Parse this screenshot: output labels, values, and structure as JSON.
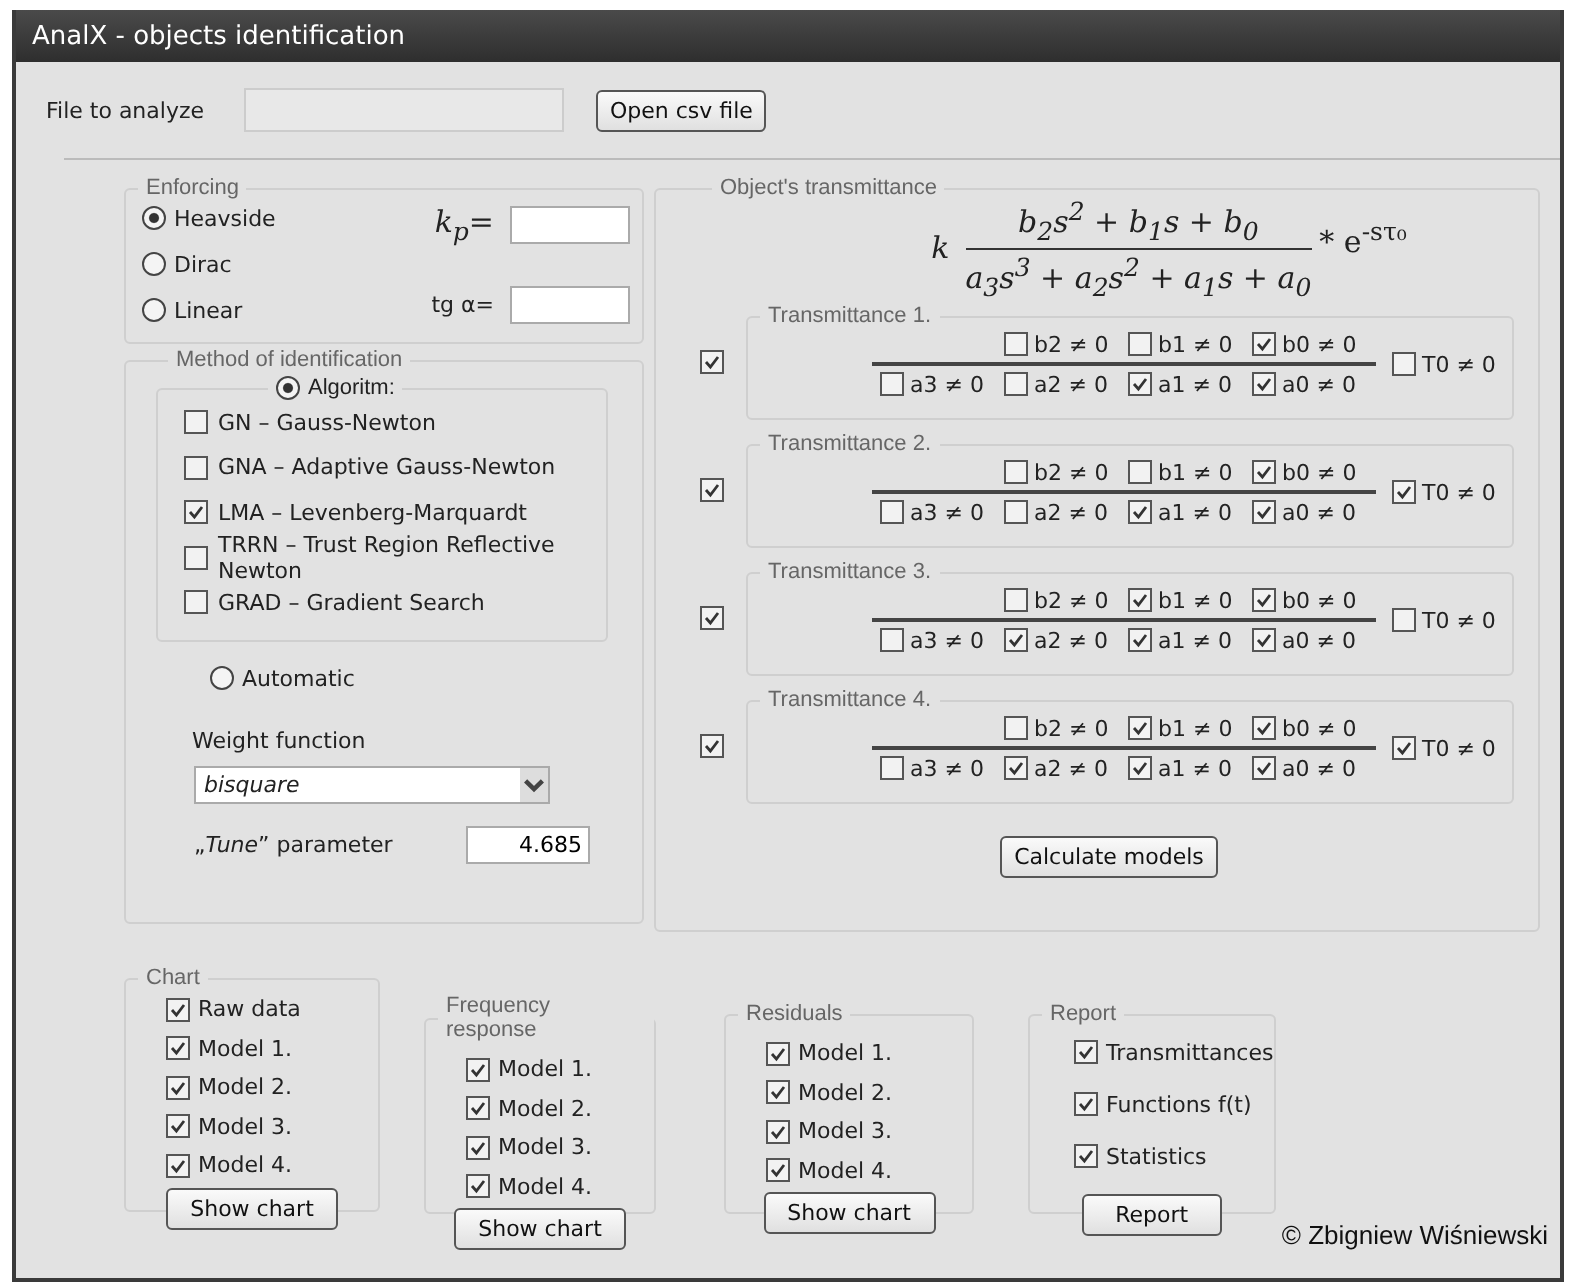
{
  "window": {
    "title": "AnalX - objects identification"
  },
  "file": {
    "label": "File to analyze",
    "button": "Open csv file"
  },
  "enforcing": {
    "title": "Enforcing",
    "kp_label": "k$_{p}$=",
    "tg_label": "tg α=",
    "options": [
      {
        "label": "Heavside",
        "selected": true
      },
      {
        "label": "Dirac",
        "selected": false
      },
      {
        "label": "Linear",
        "selected": false
      }
    ]
  },
  "method": {
    "title": "Method of identification",
    "algorithm": {
      "label": "Algoritm:",
      "selected": true,
      "items": [
        {
          "label": "GN – Gauss-Newton",
          "checked": false
        },
        {
          "label": "GNA – Adaptive Gauss-Newton",
          "checked": false
        },
        {
          "label": "LMA – Levenberg-Marquardt",
          "checked": true
        },
        {
          "label": "TRRN – Trust Region Reflective Newton",
          "checked": false
        },
        {
          "label": "GRAD – Gradient Search",
          "checked": false
        }
      ]
    },
    "automatic": {
      "label": "Automatic",
      "selected": false
    },
    "weight_label": "Weight function",
    "weight_value": "bisquare",
    "tune_label": "„*Tune*” parameter",
    "tune_value": "4.685"
  },
  "transmittance": {
    "title": "Object's transmittance",
    "formula": {
      "coefficient": "k",
      "numerator": "b$_{2}$s$^{2}$ + b$_{1}$s + b$_{0}$",
      "denominator": "a$_{3}$s$^{3}$ + a$_{2}$s$^{2}$ + a$_{1}$s + a$_{0}$",
      "exponential": "* e$^{-sτ₀}$"
    },
    "models": [
      {
        "title": "Transmittance 1.",
        "enabled": true,
        "numerator": [
          {
            "label": "b2 ≠ 0",
            "checked": false
          },
          {
            "label": "b1 ≠ 0",
            "checked": false
          },
          {
            "label": "b0 ≠ 0",
            "checked": true
          }
        ],
        "denominator": [
          {
            "label": "a3 ≠ 0",
            "checked": false
          },
          {
            "label": "a2 ≠ 0",
            "checked": false
          },
          {
            "label": "a1 ≠ 0",
            "checked": true
          },
          {
            "label": "a0 ≠ 0",
            "checked": true
          }
        ],
        "delay": {
          "label": "T0 ≠ 0",
          "checked": false
        }
      },
      {
        "title": "Transmittance 2.",
        "enabled": true,
        "numerator": [
          {
            "label": "b2 ≠ 0",
            "checked": false
          },
          {
            "label": "b1 ≠ 0",
            "checked": false
          },
          {
            "label": "b0 ≠ 0",
            "checked": true
          }
        ],
        "denominator": [
          {
            "label": "a3 ≠ 0",
            "checked": false
          },
          {
            "label": "a2 ≠ 0",
            "checked": false
          },
          {
            "label": "a1 ≠ 0",
            "checked": true
          },
          {
            "label": "a0 ≠ 0",
            "checked": true
          }
        ],
        "delay": {
          "label": "T0 ≠ 0",
          "checked": true
        }
      },
      {
        "title": "Transmittance 3.",
        "enabled": true,
        "numerator": [
          {
            "label": "b2 ≠ 0",
            "checked": false
          },
          {
            "label": "b1 ≠ 0",
            "checked": true
          },
          {
            "label": "b0 ≠ 0",
            "checked": true
          }
        ],
        "denominator": [
          {
            "label": "a3 ≠ 0",
            "checked": false
          },
          {
            "label": "a2 ≠ 0",
            "checked": true
          },
          {
            "label": "a1 ≠ 0",
            "checked": true
          },
          {
            "label": "a0 ≠ 0",
            "checked": true
          }
        ],
        "delay": {
          "label": "T0 ≠ 0",
          "checked": false
        }
      },
      {
        "title": "Transmittance 4.",
        "enabled": true,
        "numerator": [
          {
            "label": "b2 ≠ 0",
            "checked": false
          },
          {
            "label": "b1 ≠ 0",
            "checked": true
          },
          {
            "label": "b0 ≠ 0",
            "checked": true
          }
        ],
        "denominator": [
          {
            "label": "a3 ≠ 0",
            "checked": false
          },
          {
            "label": "a2 ≠ 0",
            "checked": true
          },
          {
            "label": "a1 ≠ 0",
            "checked": true
          },
          {
            "label": "a0 ≠ 0",
            "checked": true
          }
        ],
        "delay": {
          "label": "T0 ≠ 0",
          "checked": true
        }
      }
    ],
    "button": "Calculate models"
  },
  "panels": [
    {
      "kind": "list",
      "title": "Chart",
      "items": [
        {
          "label": "Raw data",
          "checked": true
        },
        {
          "label": "Model 1.",
          "checked": true
        },
        {
          "label": "Model 2.",
          "checked": true
        },
        {
          "label": "Model 3.",
          "checked": true
        },
        {
          "label": "Model 4.",
          "checked": true
        }
      ],
      "button": "Show chart"
    },
    {
      "kind": "list",
      "title": "Frequency response",
      "items": [
        {
          "label": "Model 1.",
          "checked": true
        },
        {
          "label": "Model 2.",
          "checked": true
        },
        {
          "label": "Model 3.",
          "checked": true
        },
        {
          "label": "Model 4.",
          "checked": true
        }
      ],
      "button": "Show chart"
    },
    {
      "kind": "list",
      "title": "Residuals",
      "items": [
        {
          "label": "Model 1.",
          "checked": true
        },
        {
          "label": "Model 2.",
          "checked": true
        },
        {
          "label": "Model 3.",
          "checked": true
        },
        {
          "label": "Model 4.",
          "checked": true
        }
      ],
      "button": "Show chart"
    },
    {
      "kind": "report",
      "title": "Report",
      "items": [
        {
          "label": "Transmittances",
          "checked": true
        },
        {
          "label": "Functions f(t)",
          "checked": true
        },
        {
          "label": "Statistics",
          "checked": true
        }
      ],
      "button": "Report"
    }
  ],
  "copyright": "© Zbigniew Wiśniewski"
}
